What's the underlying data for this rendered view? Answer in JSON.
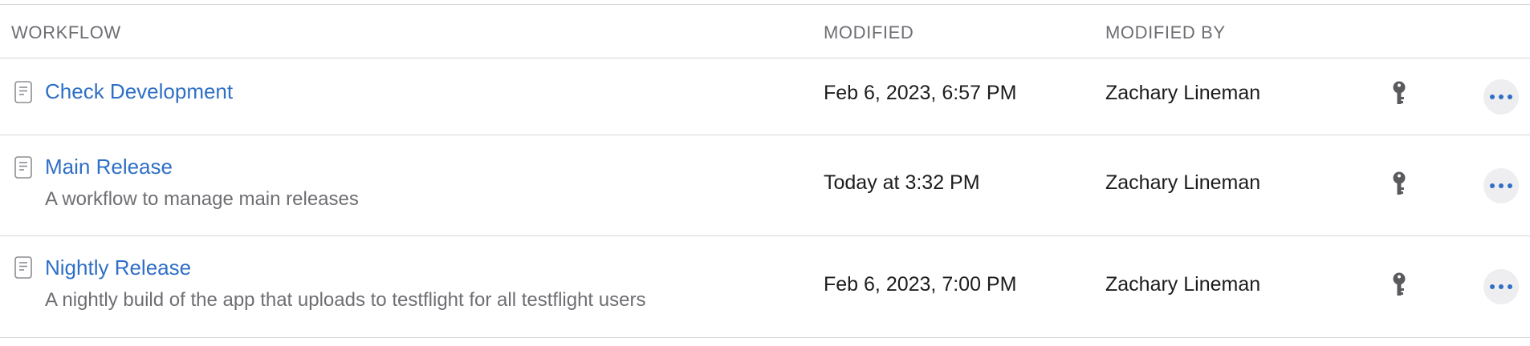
{
  "table": {
    "columns": {
      "workflow": "WORKFLOW",
      "modified": "MODIFIED",
      "modified_by": "MODIFIED BY"
    },
    "rows": [
      {
        "title": "Check Development",
        "description": "",
        "modified": "Feb 6, 2023, 6:57 PM",
        "modified_by": "Zachary Lineman",
        "icon": "document-icon",
        "lock_icon": "key-icon",
        "action_icon": "ellipsis-icon"
      },
      {
        "title": "Main Release",
        "description": "A workflow to manage main releases",
        "modified": "Today at 3:32 PM",
        "modified_by": "Zachary Lineman",
        "icon": "document-icon",
        "lock_icon": "key-icon",
        "action_icon": "ellipsis-icon"
      },
      {
        "title": "Nightly Release",
        "description": "A nightly build of the app that uploads to testflight for all testflight users",
        "modified": "Feb 6, 2023, 7:00 PM",
        "modified_by": "Zachary Lineman",
        "icon": "document-icon",
        "lock_icon": "key-icon",
        "action_icon": "ellipsis-icon"
      }
    ]
  },
  "colors": {
    "link": "#2f6fc6",
    "header_text": "#6e6e73",
    "divider": "#d6d6d6",
    "button_bg": "#eeeef0"
  }
}
